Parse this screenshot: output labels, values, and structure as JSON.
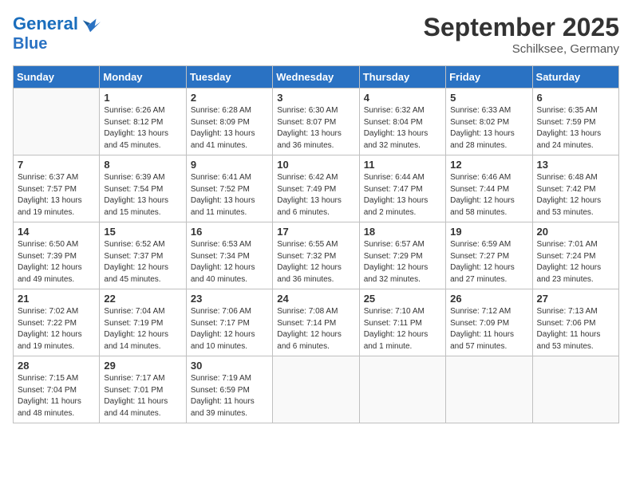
{
  "header": {
    "logo_line1": "General",
    "logo_line2": "Blue",
    "month": "September 2025",
    "location": "Schilksee, Germany"
  },
  "weekdays": [
    "Sunday",
    "Monday",
    "Tuesday",
    "Wednesday",
    "Thursday",
    "Friday",
    "Saturday"
  ],
  "weeks": [
    [
      {
        "day": "",
        "info": ""
      },
      {
        "day": "1",
        "info": "Sunrise: 6:26 AM\nSunset: 8:12 PM\nDaylight: 13 hours\nand 45 minutes."
      },
      {
        "day": "2",
        "info": "Sunrise: 6:28 AM\nSunset: 8:09 PM\nDaylight: 13 hours\nand 41 minutes."
      },
      {
        "day": "3",
        "info": "Sunrise: 6:30 AM\nSunset: 8:07 PM\nDaylight: 13 hours\nand 36 minutes."
      },
      {
        "day": "4",
        "info": "Sunrise: 6:32 AM\nSunset: 8:04 PM\nDaylight: 13 hours\nand 32 minutes."
      },
      {
        "day": "5",
        "info": "Sunrise: 6:33 AM\nSunset: 8:02 PM\nDaylight: 13 hours\nand 28 minutes."
      },
      {
        "day": "6",
        "info": "Sunrise: 6:35 AM\nSunset: 7:59 PM\nDaylight: 13 hours\nand 24 minutes."
      }
    ],
    [
      {
        "day": "7",
        "info": "Sunrise: 6:37 AM\nSunset: 7:57 PM\nDaylight: 13 hours\nand 19 minutes."
      },
      {
        "day": "8",
        "info": "Sunrise: 6:39 AM\nSunset: 7:54 PM\nDaylight: 13 hours\nand 15 minutes."
      },
      {
        "day": "9",
        "info": "Sunrise: 6:41 AM\nSunset: 7:52 PM\nDaylight: 13 hours\nand 11 minutes."
      },
      {
        "day": "10",
        "info": "Sunrise: 6:42 AM\nSunset: 7:49 PM\nDaylight: 13 hours\nand 6 minutes."
      },
      {
        "day": "11",
        "info": "Sunrise: 6:44 AM\nSunset: 7:47 PM\nDaylight: 13 hours\nand 2 minutes."
      },
      {
        "day": "12",
        "info": "Sunrise: 6:46 AM\nSunset: 7:44 PM\nDaylight: 12 hours\nand 58 minutes."
      },
      {
        "day": "13",
        "info": "Sunrise: 6:48 AM\nSunset: 7:42 PM\nDaylight: 12 hours\nand 53 minutes."
      }
    ],
    [
      {
        "day": "14",
        "info": "Sunrise: 6:50 AM\nSunset: 7:39 PM\nDaylight: 12 hours\nand 49 minutes."
      },
      {
        "day": "15",
        "info": "Sunrise: 6:52 AM\nSunset: 7:37 PM\nDaylight: 12 hours\nand 45 minutes."
      },
      {
        "day": "16",
        "info": "Sunrise: 6:53 AM\nSunset: 7:34 PM\nDaylight: 12 hours\nand 40 minutes."
      },
      {
        "day": "17",
        "info": "Sunrise: 6:55 AM\nSunset: 7:32 PM\nDaylight: 12 hours\nand 36 minutes."
      },
      {
        "day": "18",
        "info": "Sunrise: 6:57 AM\nSunset: 7:29 PM\nDaylight: 12 hours\nand 32 minutes."
      },
      {
        "day": "19",
        "info": "Sunrise: 6:59 AM\nSunset: 7:27 PM\nDaylight: 12 hours\nand 27 minutes."
      },
      {
        "day": "20",
        "info": "Sunrise: 7:01 AM\nSunset: 7:24 PM\nDaylight: 12 hours\nand 23 minutes."
      }
    ],
    [
      {
        "day": "21",
        "info": "Sunrise: 7:02 AM\nSunset: 7:22 PM\nDaylight: 12 hours\nand 19 minutes."
      },
      {
        "day": "22",
        "info": "Sunrise: 7:04 AM\nSunset: 7:19 PM\nDaylight: 12 hours\nand 14 minutes."
      },
      {
        "day": "23",
        "info": "Sunrise: 7:06 AM\nSunset: 7:17 PM\nDaylight: 12 hours\nand 10 minutes."
      },
      {
        "day": "24",
        "info": "Sunrise: 7:08 AM\nSunset: 7:14 PM\nDaylight: 12 hours\nand 6 minutes."
      },
      {
        "day": "25",
        "info": "Sunrise: 7:10 AM\nSunset: 7:11 PM\nDaylight: 12 hours\nand 1 minute."
      },
      {
        "day": "26",
        "info": "Sunrise: 7:12 AM\nSunset: 7:09 PM\nDaylight: 11 hours\nand 57 minutes."
      },
      {
        "day": "27",
        "info": "Sunrise: 7:13 AM\nSunset: 7:06 PM\nDaylight: 11 hours\nand 53 minutes."
      }
    ],
    [
      {
        "day": "28",
        "info": "Sunrise: 7:15 AM\nSunset: 7:04 PM\nDaylight: 11 hours\nand 48 minutes."
      },
      {
        "day": "29",
        "info": "Sunrise: 7:17 AM\nSunset: 7:01 PM\nDaylight: 11 hours\nand 44 minutes."
      },
      {
        "day": "30",
        "info": "Sunrise: 7:19 AM\nSunset: 6:59 PM\nDaylight: 11 hours\nand 39 minutes."
      },
      {
        "day": "",
        "info": ""
      },
      {
        "day": "",
        "info": ""
      },
      {
        "day": "",
        "info": ""
      },
      {
        "day": "",
        "info": ""
      }
    ]
  ]
}
